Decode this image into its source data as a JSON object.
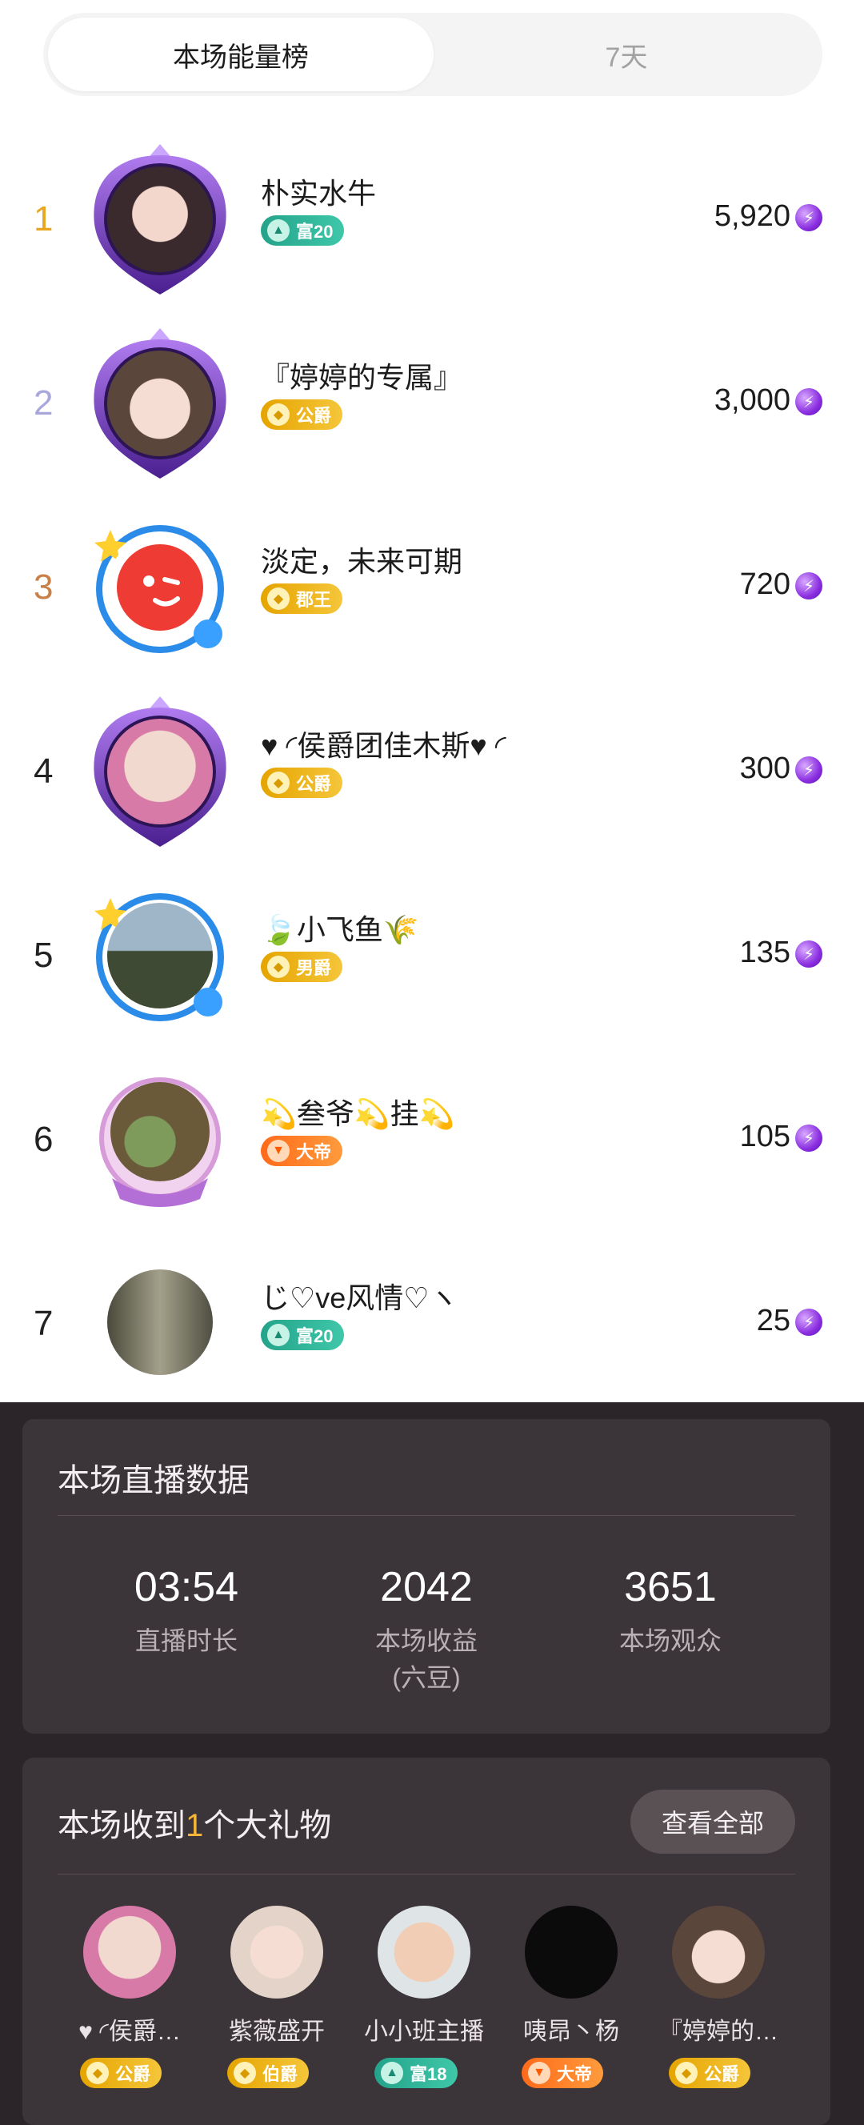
{
  "tabs": {
    "active": "本场能量榜",
    "inactive": "7天"
  },
  "ranking": [
    {
      "rank": "1",
      "name": "朴实水牛",
      "badge": "富20",
      "badge_type": "green",
      "score": "5,920",
      "rank_color": "#e8a623"
    },
    {
      "rank": "2",
      "name": "『婷婷的专属』",
      "badge": "公爵",
      "badge_type": "gold",
      "score": "3,000",
      "rank_color": "#a8a7dc"
    },
    {
      "rank": "3",
      "name": "淡定，未来可期",
      "badge": "郡王",
      "badge_type": "gold",
      "score": "720",
      "rank_color": "#c98048"
    },
    {
      "rank": "4",
      "name": "♥ ◜侯爵团佳木斯♥ ◜",
      "badge": "公爵",
      "badge_type": "gold",
      "score": "300",
      "rank_color": "#222222"
    },
    {
      "rank": "5",
      "name": "🍃小飞鱼🌾",
      "badge": "男爵",
      "badge_type": "gold",
      "score": "135",
      "rank_color": "#222222"
    },
    {
      "rank": "6",
      "name": "💫叁爷💫挂💫",
      "badge": "大帝",
      "badge_type": "orange",
      "score": "105",
      "rank_color": "#222222"
    },
    {
      "rank": "7",
      "name": "じ♡ve风情♡ヽ",
      "badge": "富20",
      "badge_type": "green",
      "score": "25",
      "rank_color": "#222222"
    }
  ],
  "live_stats": {
    "title": "本场直播数据",
    "items": [
      {
        "value": "03:54",
        "label": "直播时长",
        "sub": ""
      },
      {
        "value": "2042",
        "label": "本场收益",
        "sub": "(六豆)"
      },
      {
        "value": "3651",
        "label": "本场观众",
        "sub": ""
      }
    ]
  },
  "gifts": {
    "title_prefix": "本场收到",
    "count": "1",
    "title_suffix": "个大礼物",
    "view_all": "查看全部",
    "users": [
      {
        "name": "♥ ◜侯爵…",
        "badge": "公爵",
        "badge_type": "gold"
      },
      {
        "name": "紫薇盛开",
        "badge": "伯爵",
        "badge_type": "gold"
      },
      {
        "name": "小小班主播",
        "badge": "富18",
        "badge_type": "green"
      },
      {
        "name": "咦昂丶杨",
        "badge": "大帝",
        "badge_type": "orange"
      },
      {
        "name": "『婷婷的…",
        "badge": "公爵",
        "badge_type": "gold"
      }
    ]
  },
  "icons": {
    "currency": "energy-gem-icon",
    "accent": "#f5b43a"
  }
}
